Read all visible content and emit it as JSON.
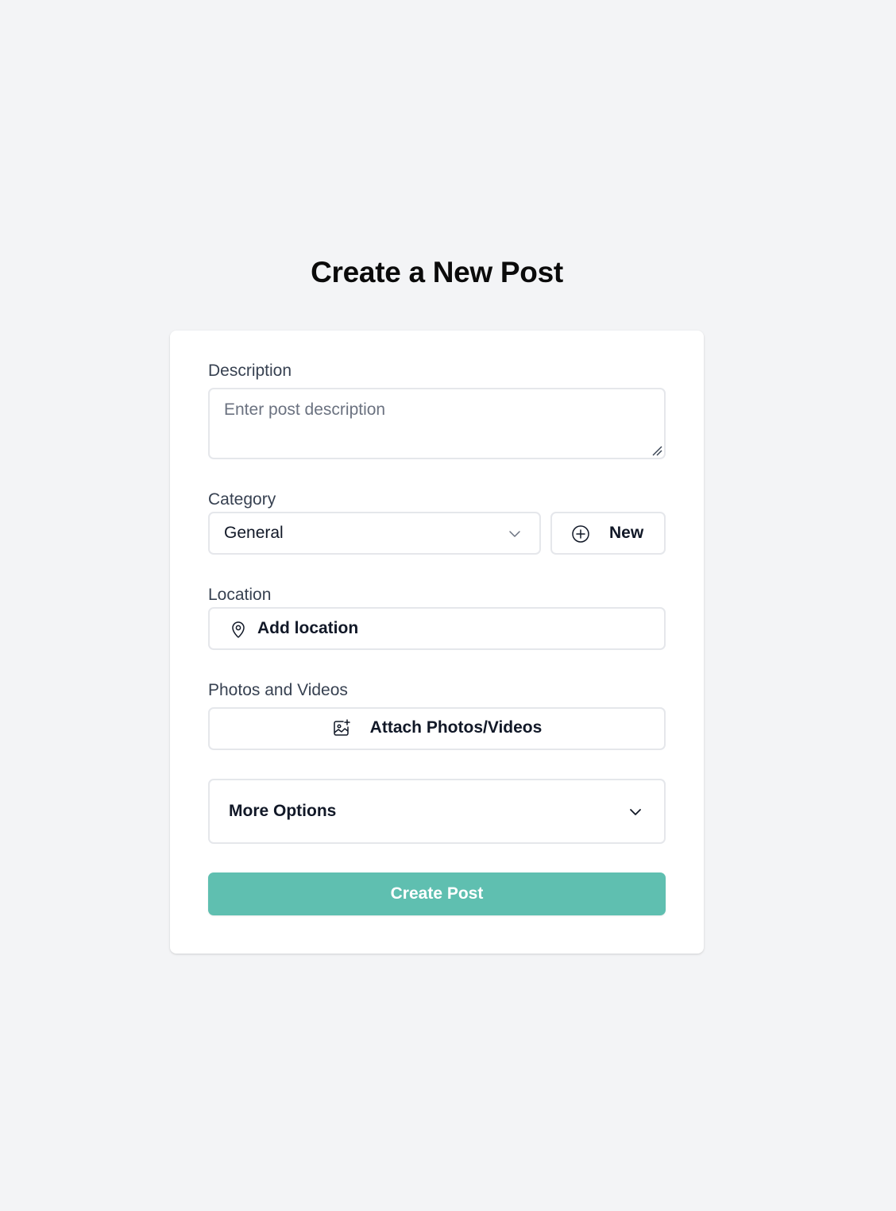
{
  "page": {
    "title": "Create a New Post"
  },
  "form": {
    "description": {
      "label": "Description",
      "placeholder": "Enter post description",
      "value": ""
    },
    "category": {
      "label": "Category",
      "selected": "General",
      "new_button_label": "New"
    },
    "location": {
      "label": "Location",
      "button_label": "Add location"
    },
    "media": {
      "label": "Photos and Videos",
      "button_label": "Attach Photos/Videos"
    },
    "more_options": {
      "label": "More Options",
      "expanded": false
    },
    "submit": {
      "label": "Create Post"
    }
  },
  "colors": {
    "background": "#f3f4f6",
    "card": "#ffffff",
    "accent": "#5fbfb0",
    "border": "#e5e7eb"
  },
  "icons": [
    "chevron-down-icon",
    "plus-circle-icon",
    "map-pin-icon",
    "image-add-icon",
    "resize-handle-icon"
  ]
}
